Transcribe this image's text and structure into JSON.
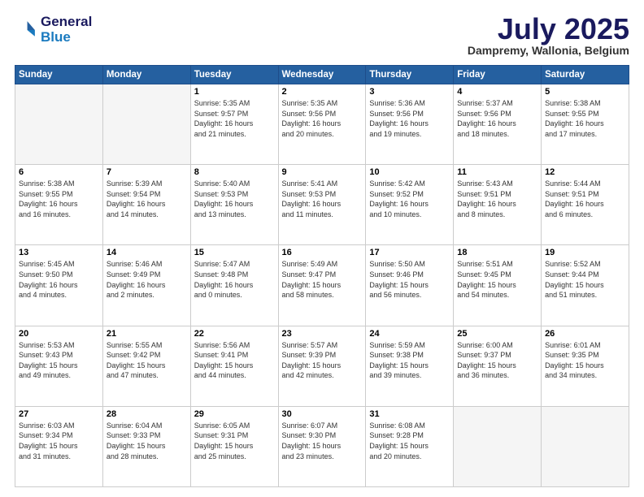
{
  "logo": {
    "line1": "General",
    "line2": "Blue"
  },
  "title": "July 2025",
  "subtitle": "Dampremy, Wallonia, Belgium",
  "weekdays": [
    "Sunday",
    "Monday",
    "Tuesday",
    "Wednesday",
    "Thursday",
    "Friday",
    "Saturday"
  ],
  "weeks": [
    [
      {
        "day": "",
        "info": ""
      },
      {
        "day": "",
        "info": ""
      },
      {
        "day": "1",
        "info": "Sunrise: 5:35 AM\nSunset: 9:57 PM\nDaylight: 16 hours\nand 21 minutes."
      },
      {
        "day": "2",
        "info": "Sunrise: 5:35 AM\nSunset: 9:56 PM\nDaylight: 16 hours\nand 20 minutes."
      },
      {
        "day": "3",
        "info": "Sunrise: 5:36 AM\nSunset: 9:56 PM\nDaylight: 16 hours\nand 19 minutes."
      },
      {
        "day": "4",
        "info": "Sunrise: 5:37 AM\nSunset: 9:56 PM\nDaylight: 16 hours\nand 18 minutes."
      },
      {
        "day": "5",
        "info": "Sunrise: 5:38 AM\nSunset: 9:55 PM\nDaylight: 16 hours\nand 17 minutes."
      }
    ],
    [
      {
        "day": "6",
        "info": "Sunrise: 5:38 AM\nSunset: 9:55 PM\nDaylight: 16 hours\nand 16 minutes."
      },
      {
        "day": "7",
        "info": "Sunrise: 5:39 AM\nSunset: 9:54 PM\nDaylight: 16 hours\nand 14 minutes."
      },
      {
        "day": "8",
        "info": "Sunrise: 5:40 AM\nSunset: 9:53 PM\nDaylight: 16 hours\nand 13 minutes."
      },
      {
        "day": "9",
        "info": "Sunrise: 5:41 AM\nSunset: 9:53 PM\nDaylight: 16 hours\nand 11 minutes."
      },
      {
        "day": "10",
        "info": "Sunrise: 5:42 AM\nSunset: 9:52 PM\nDaylight: 16 hours\nand 10 minutes."
      },
      {
        "day": "11",
        "info": "Sunrise: 5:43 AM\nSunset: 9:51 PM\nDaylight: 16 hours\nand 8 minutes."
      },
      {
        "day": "12",
        "info": "Sunrise: 5:44 AM\nSunset: 9:51 PM\nDaylight: 16 hours\nand 6 minutes."
      }
    ],
    [
      {
        "day": "13",
        "info": "Sunrise: 5:45 AM\nSunset: 9:50 PM\nDaylight: 16 hours\nand 4 minutes."
      },
      {
        "day": "14",
        "info": "Sunrise: 5:46 AM\nSunset: 9:49 PM\nDaylight: 16 hours\nand 2 minutes."
      },
      {
        "day": "15",
        "info": "Sunrise: 5:47 AM\nSunset: 9:48 PM\nDaylight: 16 hours\nand 0 minutes."
      },
      {
        "day": "16",
        "info": "Sunrise: 5:49 AM\nSunset: 9:47 PM\nDaylight: 15 hours\nand 58 minutes."
      },
      {
        "day": "17",
        "info": "Sunrise: 5:50 AM\nSunset: 9:46 PM\nDaylight: 15 hours\nand 56 minutes."
      },
      {
        "day": "18",
        "info": "Sunrise: 5:51 AM\nSunset: 9:45 PM\nDaylight: 15 hours\nand 54 minutes."
      },
      {
        "day": "19",
        "info": "Sunrise: 5:52 AM\nSunset: 9:44 PM\nDaylight: 15 hours\nand 51 minutes."
      }
    ],
    [
      {
        "day": "20",
        "info": "Sunrise: 5:53 AM\nSunset: 9:43 PM\nDaylight: 15 hours\nand 49 minutes."
      },
      {
        "day": "21",
        "info": "Sunrise: 5:55 AM\nSunset: 9:42 PM\nDaylight: 15 hours\nand 47 minutes."
      },
      {
        "day": "22",
        "info": "Sunrise: 5:56 AM\nSunset: 9:41 PM\nDaylight: 15 hours\nand 44 minutes."
      },
      {
        "day": "23",
        "info": "Sunrise: 5:57 AM\nSunset: 9:39 PM\nDaylight: 15 hours\nand 42 minutes."
      },
      {
        "day": "24",
        "info": "Sunrise: 5:59 AM\nSunset: 9:38 PM\nDaylight: 15 hours\nand 39 minutes."
      },
      {
        "day": "25",
        "info": "Sunrise: 6:00 AM\nSunset: 9:37 PM\nDaylight: 15 hours\nand 36 minutes."
      },
      {
        "day": "26",
        "info": "Sunrise: 6:01 AM\nSunset: 9:35 PM\nDaylight: 15 hours\nand 34 minutes."
      }
    ],
    [
      {
        "day": "27",
        "info": "Sunrise: 6:03 AM\nSunset: 9:34 PM\nDaylight: 15 hours\nand 31 minutes."
      },
      {
        "day": "28",
        "info": "Sunrise: 6:04 AM\nSunset: 9:33 PM\nDaylight: 15 hours\nand 28 minutes."
      },
      {
        "day": "29",
        "info": "Sunrise: 6:05 AM\nSunset: 9:31 PM\nDaylight: 15 hours\nand 25 minutes."
      },
      {
        "day": "30",
        "info": "Sunrise: 6:07 AM\nSunset: 9:30 PM\nDaylight: 15 hours\nand 23 minutes."
      },
      {
        "day": "31",
        "info": "Sunrise: 6:08 AM\nSunset: 9:28 PM\nDaylight: 15 hours\nand 20 minutes."
      },
      {
        "day": "",
        "info": ""
      },
      {
        "day": "",
        "info": ""
      }
    ]
  ]
}
